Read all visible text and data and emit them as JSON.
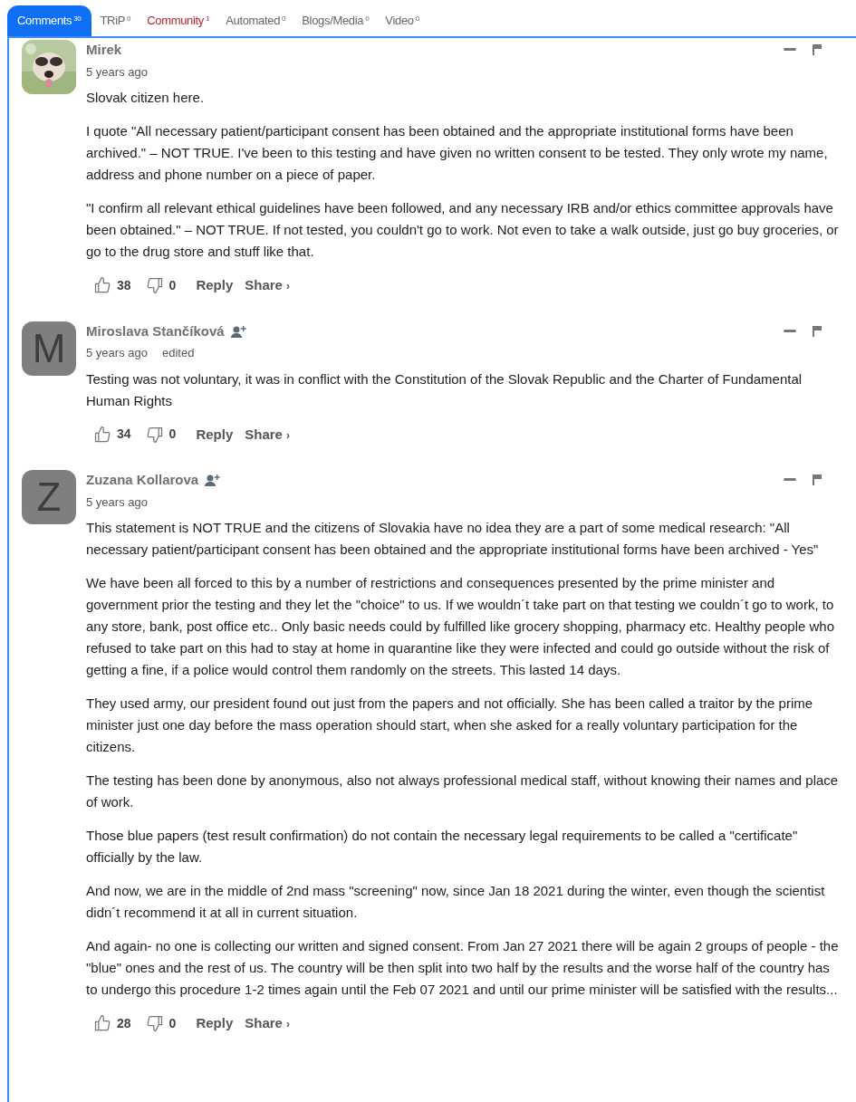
{
  "tabs": [
    {
      "label": "Comments",
      "count": "30",
      "selected": true,
      "color": "#ffffff"
    },
    {
      "label": "TRiP",
      "count": "0",
      "selected": false,
      "color": "#666666"
    },
    {
      "label": "Community",
      "count": "1",
      "selected": false,
      "color": "#b3262b"
    },
    {
      "label": "Automated",
      "count": "0",
      "selected": false,
      "color": "#666666"
    },
    {
      "label": "Blogs/Media",
      "count": "0",
      "selected": false,
      "color": "#666666"
    },
    {
      "label": "Video",
      "count": "0",
      "selected": false,
      "color": "#666666"
    }
  ],
  "comments": [
    {
      "name": "Mirek",
      "follow": false,
      "time": "5 years ago",
      "paragraphs": [
        "Slovak citizen here.",
        "I quote \"All necessary patient/participant consent has been obtained and the appropriate institutional forms have been archived.\" – NOT TRUE. I've been to this testing and have given no written consent to be tested. They only wrote my name, address and phone number on a piece of paper.",
        "\"I confirm all relevant ethical guidelines have been followed, and any necessary IRB and/or ethics committee approvals have been obtained.\" – NOT TRUE. If not tested, you couldn't go to work. Not even to take a walk outside, just go buy groceries, or go to the drug store and stuff like that."
      ],
      "likes": "38",
      "dislikes": "0",
      "reply": "Reply",
      "share": "Share",
      "chevron": "›"
    },
    {
      "avatar": {
        "kind": "letter",
        "letter": "M"
      },
      "name": "Miroslava Stančíková",
      "follow": true,
      "time": "5 years ago",
      "edited": "edited",
      "paragraphs": [
        "Testing was not voluntary, it was in conflict with the Constitution of the Slovak Republic and the Charter of Fundamental Human Rights"
      ],
      "likes": "34",
      "dislikes": "0",
      "reply": "Reply",
      "share": "Share",
      "chevron": "›"
    },
    {
      "avatar": {
        "kind": "letter",
        "letter": "Z"
      },
      "name": "Zuzana Kollarova",
      "follow": true,
      "time": "5 years ago",
      "paragraphs": [
        "This statement is NOT TRUE and the citizens of Slovakia have no idea they are a part of some medical research: \"All necessary patient/participant consent has been obtained and the appropriate institutional forms have been archived - Yes\"",
        "We have been all forced to this by a number of restrictions and consequences presented by the prime minister and government prior the testing and they let the \"choice\" to us. If we wouldn´t take part on that testing we couldn´t go to work, to any store, bank, post office etc.. Only basic needs could by fulfilled like grocery shopping, pharmacy etc. Healthy people who refused to take part on this had to stay at home in quarantine like they were infected and could go outside without the risk of getting a fine, if a police would control them randomly on the streets. This lasted 14 days.",
        "They used army, our president found out just from the papers and not officially. She has been called a traitor by the prime minister just one day before the mass operation should start, when she asked for a really voluntary participation for the citizens.",
        "The testing has been done by anonymous, also not always professional medical staff, without knowing their names and place of work.",
        "Those blue papers (test result confirmation) do not contain the necessary legal requirements to be called a \"certificate\" officially by the law.",
        "And now, we are in the middle of 2nd mass \"screening\" now, since Jan 18 2021 during the winter, even though the scientist didn´t recommend it at all in current situation.",
        "And again- no one is collecting our written and signed consent. From Jan 27 2021 there will be again 2 groups of people - the \"blue\" ones and the rest of us. The country will be then split into two half by the results and the worse half of the country has to undergo this procedure 1-2 times again until the Feb 07 2021 and until our prime minister will be satisfied with the results..."
      ],
      "likes": "28",
      "dislikes": "0",
      "reply": "Reply",
      "share": "Share",
      "chevron": "›"
    }
  ]
}
